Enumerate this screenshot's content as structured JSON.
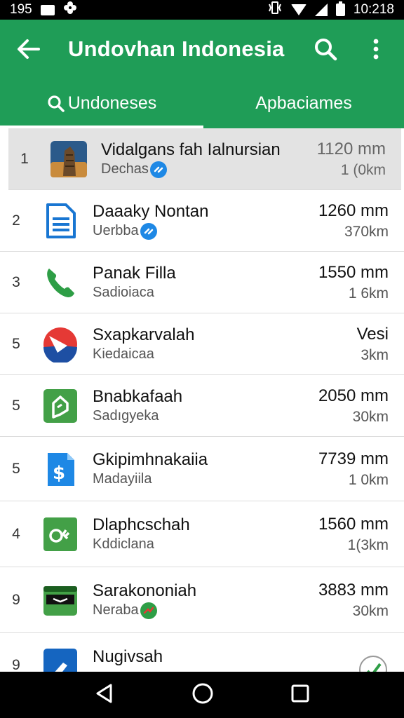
{
  "status": {
    "time_left": "195",
    "time_right": "10:218"
  },
  "header": {
    "title": "Undovhan Indonesia"
  },
  "tabs": [
    {
      "label": "Undoneses"
    },
    {
      "label": "Apbaciames"
    }
  ],
  "rows": [
    {
      "rank": "1",
      "name": "Vidalgans fah Ialnursian",
      "sub": "Dechas",
      "v1": "1120 mm",
      "v2": "1 (0km",
      "icon": "building-photo-icon"
    },
    {
      "rank": "2",
      "name": "Daaaky Nontan",
      "sub": "Uerbba",
      "v1": "1260 mm",
      "v2": "370km",
      "icon": "document-icon"
    },
    {
      "rank": "3",
      "name": "Panak Filla",
      "sub": "Sadioiaca",
      "v1": "1550 mm",
      "v2": "1 6km",
      "icon": "phone-icon"
    },
    {
      "rank": "5",
      "name": "Sxapkarvalah",
      "sub": "Kiedaicaa",
      "v1": "Vesi",
      "v2": "3km",
      "icon": "red-blue-logo-icon"
    },
    {
      "rank": "5",
      "name": "Bnabkafaah",
      "sub": "Sadıgyeka",
      "v1": "2050 mm",
      "v2": "30km",
      "icon": "green-house-icon"
    },
    {
      "rank": "5",
      "name": "Gkipimhnakaiia",
      "sub": "Madayiila",
      "v1": "7739 mm",
      "v2": "1 0km",
      "icon": "dollar-document-icon"
    },
    {
      "rank": "4",
      "name": "Dlaphcschah",
      "sub": "Kddiclana",
      "v1": "1560 mm",
      "v2": "1(3km",
      "icon": "green-ok-icon"
    },
    {
      "rank": "9",
      "name": "Sarakononiah",
      "sub": "Neraba",
      "v1": "3883 mm",
      "v2": "30km",
      "icon": "wallet-icon"
    },
    {
      "rank": "9",
      "name": "Nugivsah",
      "sub": "",
      "v1": "",
      "v2": "",
      "icon": "blue-tool-icon"
    }
  ]
}
